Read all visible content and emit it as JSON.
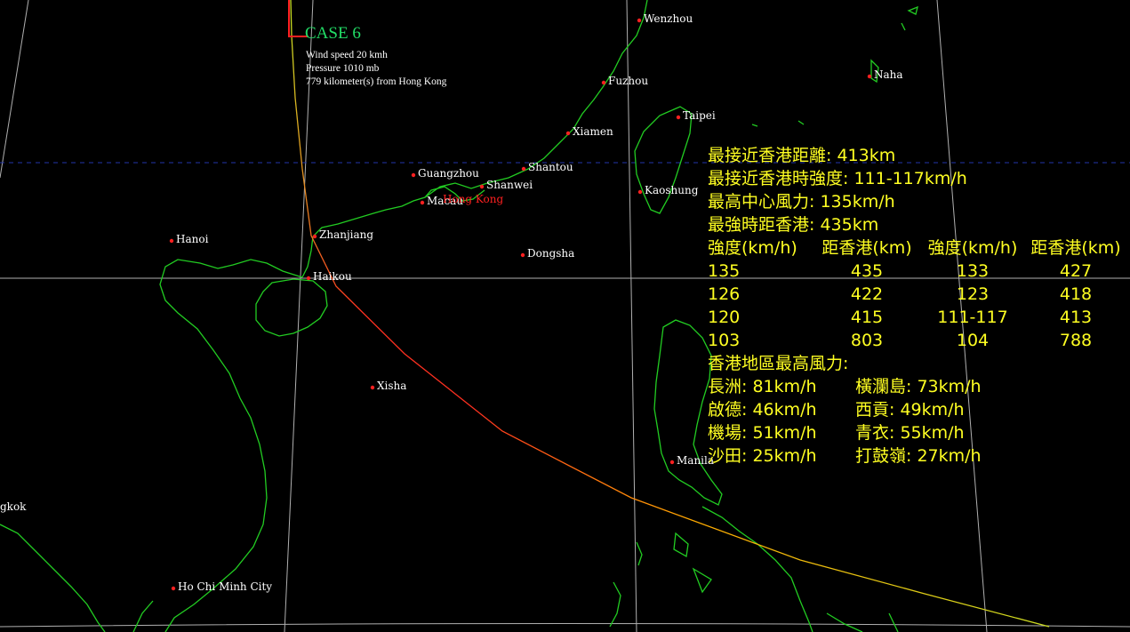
{
  "case": {
    "title": "CASE 6",
    "info": [
      "Wind speed 20 kmh",
      "Pressure 1010 mb",
      "779 kilometer(s) from Hong Kong"
    ]
  },
  "cities": [
    {
      "name": "Wenzhou"
    },
    {
      "name": "Naha"
    },
    {
      "name": "Fuzhou"
    },
    {
      "name": "Taipei"
    },
    {
      "name": "Xiamen"
    },
    {
      "name": "Shantou"
    },
    {
      "name": "Guangzhou"
    },
    {
      "name": "Shanwei"
    },
    {
      "name": "Kaoshung"
    },
    {
      "name": "Macau"
    },
    {
      "name": "Hong Kong"
    },
    {
      "name": "Hanoi"
    },
    {
      "name": "Zhanjiang"
    },
    {
      "name": "Dongsha"
    },
    {
      "name": "Haikou"
    },
    {
      "name": "Xisha"
    },
    {
      "name": "Manila"
    },
    {
      "name": "gkok"
    },
    {
      "name": "Ho Chi Minh City"
    }
  ],
  "summary": {
    "closest_distance": "最接近香港距離: 413km",
    "closest_intensity": "最接近香港時強度: 111-117km/h",
    "max_wind": "最高中心風力: 135km/h",
    "strongest_distance": "最強時距香港: 435km"
  },
  "intensity_table": {
    "headers": [
      "強度(km/h)",
      "距香港(km)",
      "強度(km/h)",
      "距香港(km)"
    ],
    "rows": [
      [
        "135",
        "435",
        "133",
        "427"
      ],
      [
        "126",
        "422",
        "123",
        "418"
      ],
      [
        "120",
        "415",
        "111-117",
        "413"
      ],
      [
        "103",
        "803",
        "104",
        "788"
      ]
    ]
  },
  "hk_winds": {
    "title": "香港地區最高風力:",
    "stations": [
      [
        "長洲: 81km/h",
        "橫瀾島: 73km/h"
      ],
      [
        "啟德: 46km/h",
        "西貢: 49km/h"
      ],
      [
        "機場: 51km/h",
        "青衣: 55km/h"
      ],
      [
        "沙田: 25km/h",
        "打鼓嶺: 27km/h"
      ]
    ]
  },
  "colors": {
    "background": "#000000",
    "coastline": "#22cc22",
    "grid": "#b0b0b0",
    "tropic_line": "#2233aa",
    "city_dot": "#ff2020",
    "panel_text": "#ffff22",
    "case_title": "#22dd66",
    "track_start": "#ccdd22",
    "track_mid": "#ffaa00",
    "track_end": "#ff2020"
  }
}
